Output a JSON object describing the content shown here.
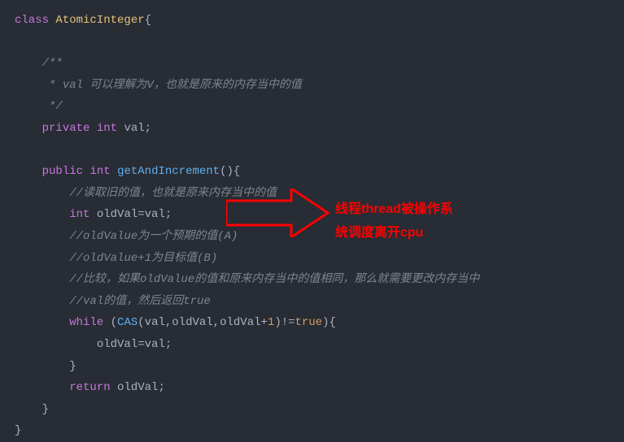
{
  "code": {
    "line1_kw": "class",
    "line1_cn": "AtomicInteger",
    "line1_brace": "{",
    "line3_c": "/**",
    "line4_c": " * val 可以理解为V，也就是原来的内存当中的值",
    "line5_c": " */",
    "line6_kw1": "private",
    "line6_kw2": "int",
    "line6_var": " val;",
    "line8_kw1": "public",
    "line8_kw2": "int",
    "line8_mn": "getAndIncrement",
    "line8_paren": "(){",
    "line9_c": "//读取旧的值，也就是原来内存当中的值",
    "line10_kw": "int",
    "line10_rest": " oldVal=val;",
    "line11_c": "//oldValue为一个预期的值(A)",
    "line12_c": "//oldValue+1为目标值(B)",
    "line13_c": "//比较，如果oldValue的值和原来内存当中的值相同，那么就需要更改内存当中",
    "line14_c": "//val的值，然后返回true",
    "line15_kw": "while",
    "line15_p1": " (",
    "line15_fn": "CAS",
    "line15_args": "(val,oldVal,oldVal+",
    "line15_num": "1",
    "line15_p2": ")!=",
    "line15_lit": "true",
    "line15_p3": "){",
    "line16": "oldVal=val;",
    "line17": "}",
    "line18_kw": "return",
    "line18_rest": " oldVal;",
    "line19": "}",
    "line20": "}"
  },
  "annotation": {
    "line1": "线程thread被操作系",
    "line2": "统调度离开cpu"
  }
}
